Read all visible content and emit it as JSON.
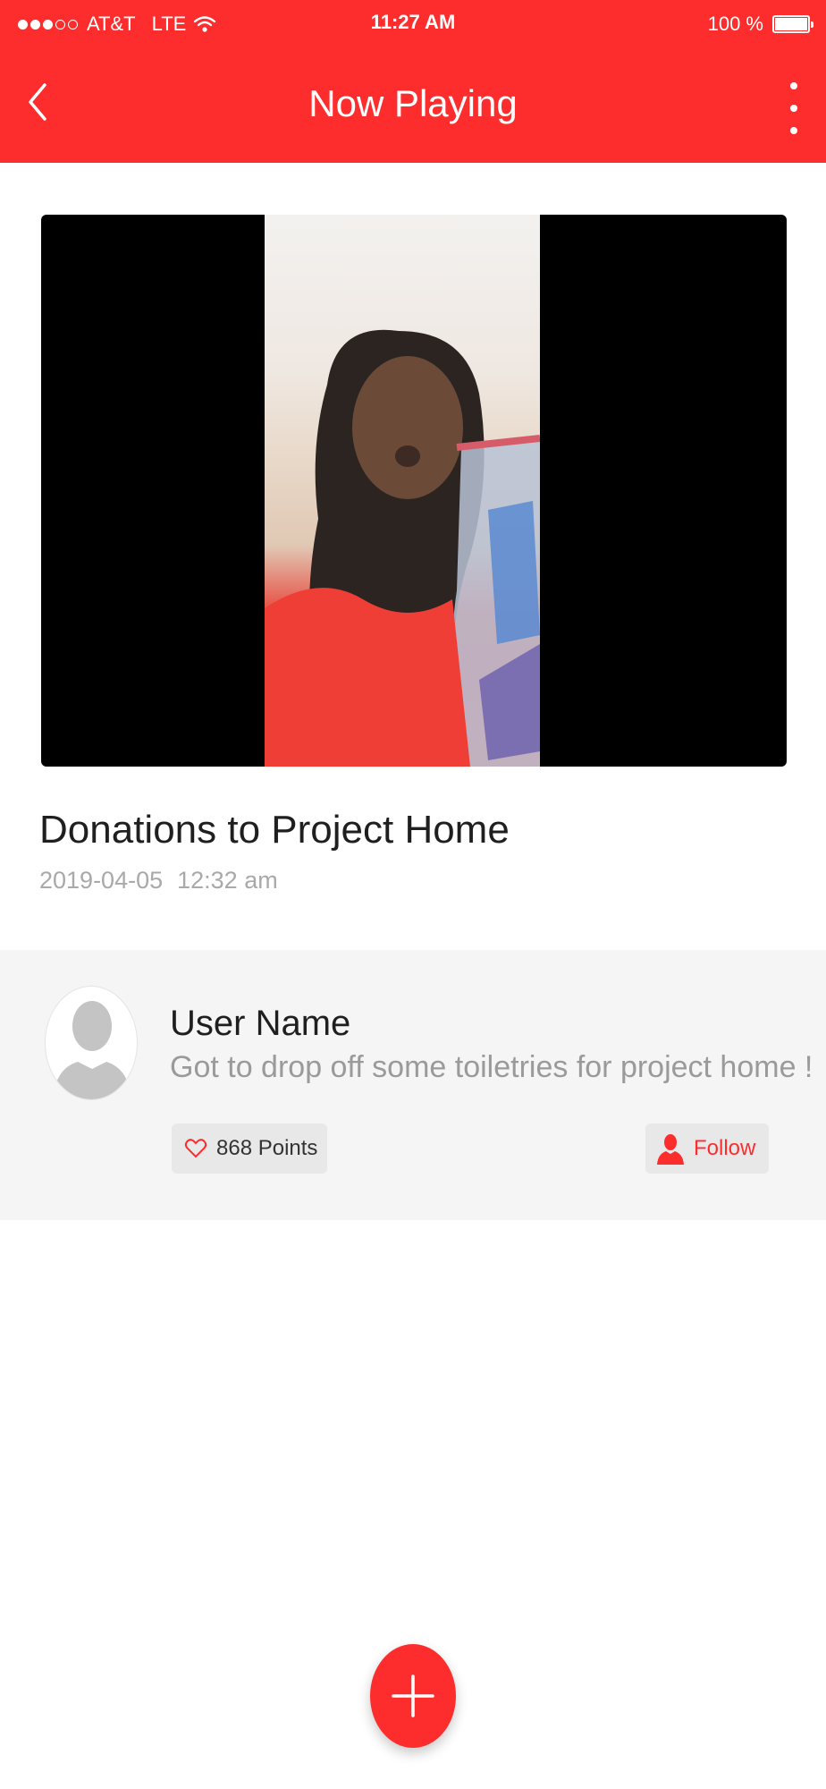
{
  "status_bar": {
    "carrier": "AT&T",
    "network": "LTE",
    "time": "11:27 AM",
    "battery_text": "100 %",
    "battery_level": 1.0,
    "signal_bars_filled": 3,
    "signal_bars_total": 5
  },
  "nav": {
    "title": "Now Playing",
    "back_icon": "chevron-left-icon",
    "more_icon": "vertical-ellipsis-icon"
  },
  "post": {
    "title": "Donations to Project Home",
    "date": "2019-04-05",
    "time": "12:32 am"
  },
  "user": {
    "name": "User Name",
    "caption": "Got to drop off some toiletries for project home !",
    "points_label": "868 Points",
    "follow_label": "Follow"
  },
  "colors": {
    "accent": "#fd2d2e",
    "card_background": "#f5f5f5",
    "muted_text": "#a9a9a9"
  }
}
